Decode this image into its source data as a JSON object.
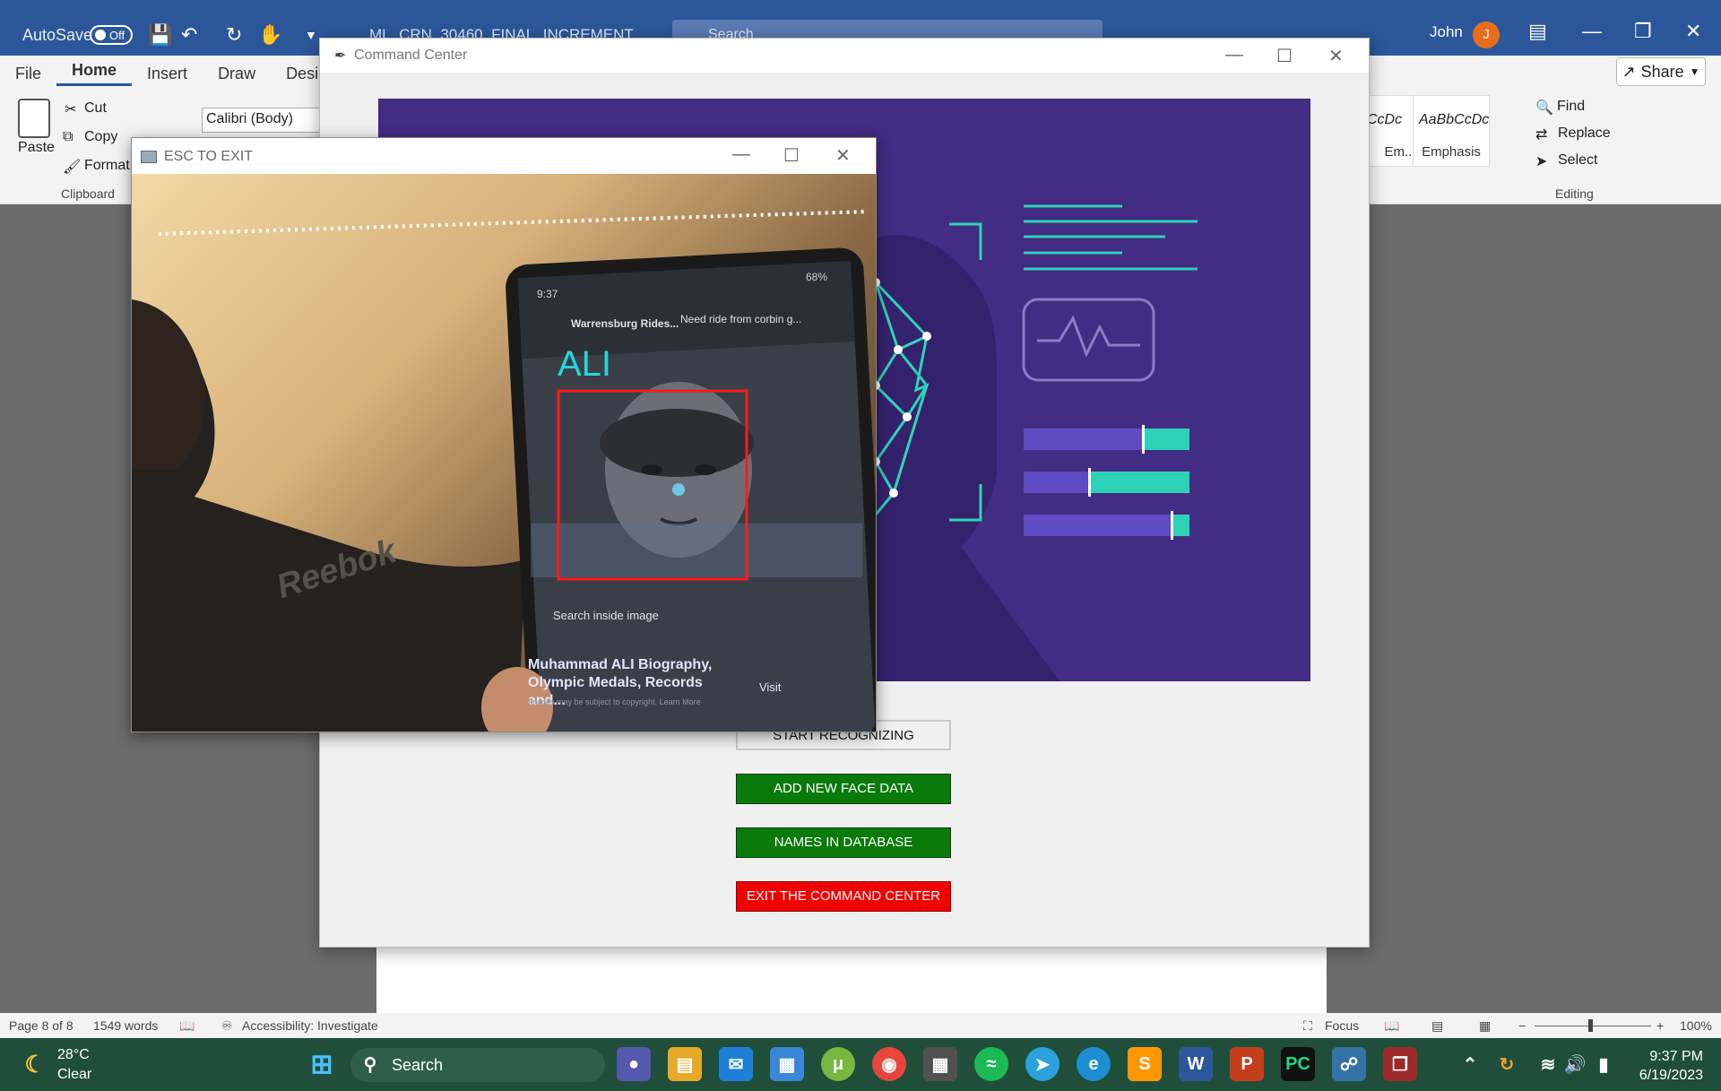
{
  "word": {
    "autosave_label": "AutoSave",
    "autosave_state": "Off",
    "doc_name": "ML_CRN_30460_FINAL_INCREMENT",
    "search_placeholder": "Search",
    "user_name": "John",
    "user_initial": "J",
    "tabs": [
      "File",
      "Home",
      "Insert",
      "Draw",
      "Design"
    ],
    "share_label": "Share",
    "clipboard": {
      "paste": "Paste",
      "cut": "Cut",
      "copy": "Copy",
      "format": "Format",
      "group": "Clipboard"
    },
    "font_name": "Calibri (Body)",
    "styles": [
      {
        "sample": "CcDc",
        "name": "Em..."
      },
      {
        "sample": "AaBbCcDc",
        "name": "Emphasis"
      }
    ],
    "editing": {
      "find": "Find",
      "replace": "Replace",
      "select": "Select",
      "group": "Editing"
    },
    "status": {
      "page": "Page 8 of 8",
      "words": "1549 words",
      "accessibility": "Accessibility: Investigate",
      "focus": "Focus",
      "zoom": "100%"
    }
  },
  "command_center": {
    "title": "Command Center",
    "buttons": {
      "start": "START RECOGNIZING",
      "add_face": "ADD NEW FACE DATA",
      "names": "NAMES IN DATABASE",
      "exit": "EXIT THE COMMAND CENTER"
    },
    "colors": {
      "banner": "#432c83",
      "accent": "#2ed3b7",
      "green": "#0a7a0a",
      "red": "#f00000"
    }
  },
  "webcam": {
    "title": "ESC TO EXIT",
    "recognized_name": "ALI",
    "phone": {
      "time": "9:37",
      "battery": "68%",
      "notif_title": "Warrensburg Rides...",
      "notif_body": "Need ride from corbin g...",
      "search_inside": "Search inside image",
      "article_title": "Muhammad ALI Biography, Olympic Medals, Records and...",
      "visit": "Visit",
      "fine_print": "Images may be subject to copyright. Learn More"
    },
    "shirt_text": "Reebok"
  },
  "taskbar": {
    "temp": "28°C",
    "condition": "Clear",
    "search": "Search",
    "time": "9:37 PM",
    "date": "6/19/2023"
  }
}
